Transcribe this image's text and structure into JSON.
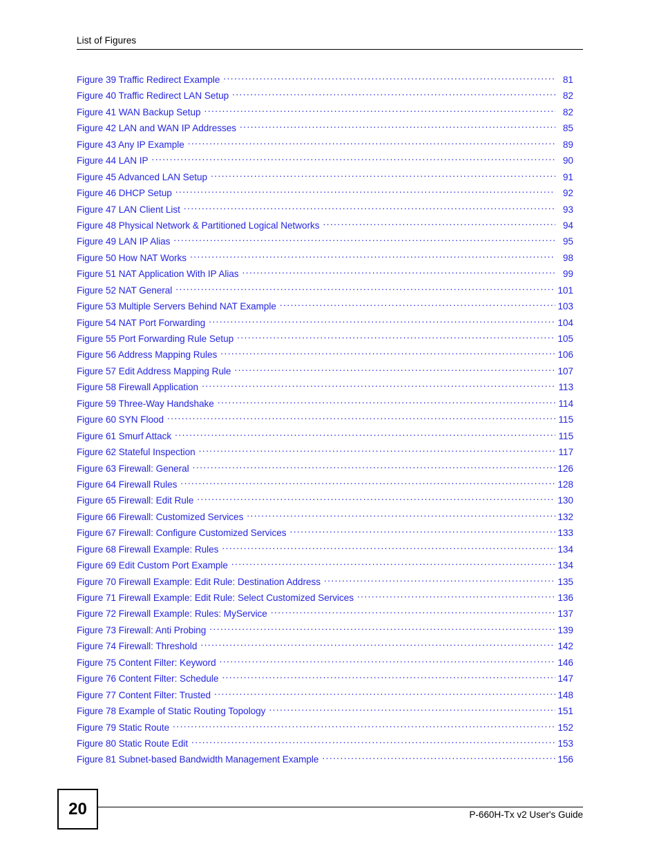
{
  "header": {
    "title": "List of Figures"
  },
  "colors": {
    "entry_blue": "#2626e0",
    "text_black": "#000000",
    "page_background": "#ffffff"
  },
  "toc": {
    "entries": [
      {
        "label": "Figure 39 Traffic Redirect Example",
        "page": "81"
      },
      {
        "label": "Figure 40 Traffic Redirect LAN Setup",
        "page": "82"
      },
      {
        "label": "Figure 41 WAN Backup Setup",
        "page": "82"
      },
      {
        "label": "Figure 42 LAN and WAN IP Addresses",
        "page": "85"
      },
      {
        "label": "Figure 43 Any IP Example",
        "page": "89"
      },
      {
        "label": "Figure 44 LAN IP",
        "page": "90"
      },
      {
        "label": "Figure 45 Advanced LAN Setup",
        "page": "91"
      },
      {
        "label": "Figure 46 DHCP Setup",
        "page": "92"
      },
      {
        "label": "Figure 47 LAN Client List",
        "page": "93"
      },
      {
        "label": "Figure 48 Physical Network & Partitioned Logical Networks",
        "page": "94"
      },
      {
        "label": "Figure 49 LAN IP Alias",
        "page": "95"
      },
      {
        "label": "Figure 50 How NAT Works",
        "page": "98"
      },
      {
        "label": "Figure 51 NAT Application With IP Alias",
        "page": "99"
      },
      {
        "label": "Figure 52 NAT General",
        "page": "101"
      },
      {
        "label": "Figure 53 Multiple Servers Behind NAT Example",
        "page": "103"
      },
      {
        "label": "Figure 54 NAT Port Forwarding",
        "page": "104"
      },
      {
        "label": "Figure 55 Port Forwarding Rule Setup",
        "page": "105"
      },
      {
        "label": "Figure 56 Address Mapping Rules",
        "page": "106"
      },
      {
        "label": "Figure 57 Edit Address Mapping Rule",
        "page": "107"
      },
      {
        "label": "Figure 58 Firewall Application",
        "page": "113"
      },
      {
        "label": "Figure 59 Three-Way Handshake",
        "page": "114"
      },
      {
        "label": "Figure 60 SYN Flood",
        "page": "115"
      },
      {
        "label": "Figure 61 Smurf Attack",
        "page": "115"
      },
      {
        "label": "Figure 62 Stateful Inspection",
        "page": "117"
      },
      {
        "label": "Figure 63 Firewall: General",
        "page": "126"
      },
      {
        "label": "Figure 64 Firewall Rules",
        "page": "128"
      },
      {
        "label": "Figure 65 Firewall: Edit Rule",
        "page": "130"
      },
      {
        "label": "Figure 66 Firewall: Customized Services",
        "page": "132"
      },
      {
        "label": "Figure 67 Firewall: Configure Customized Services",
        "page": "133"
      },
      {
        "label": "Figure 68 Firewall Example: Rules",
        "page": "134"
      },
      {
        "label": "Figure 69 Edit Custom Port Example",
        "page": "134"
      },
      {
        "label": "Figure 70 Firewall Example: Edit Rule: Destination Address",
        "page": "135"
      },
      {
        "label": "Figure 71 Firewall Example: Edit Rule: Select Customized Services",
        "page": "136"
      },
      {
        "label": "Figure 72 Firewall Example: Rules: MyService",
        "page": "137"
      },
      {
        "label": "Figure 73 Firewall: Anti Probing",
        "page": "139"
      },
      {
        "label": "Figure 74 Firewall: Threshold",
        "page": "142"
      },
      {
        "label": "Figure 75 Content Filter: Keyword",
        "page": "146"
      },
      {
        "label": "Figure 76 Content Filter: Schedule",
        "page": "147"
      },
      {
        "label": "Figure 77 Content Filter: Trusted",
        "page": "148"
      },
      {
        "label": "Figure 78 Example of Static Routing Topology",
        "page": "151"
      },
      {
        "label": "Figure 79 Static Route",
        "page": "152"
      },
      {
        "label": "Figure 80 Static Route Edit",
        "page": "153"
      },
      {
        "label": "Figure 81 Subnet-based Bandwidth Management Example",
        "page": "156"
      }
    ]
  },
  "footer": {
    "page_number": "20",
    "document_title": "P-660H-Tx v2 User's Guide"
  }
}
